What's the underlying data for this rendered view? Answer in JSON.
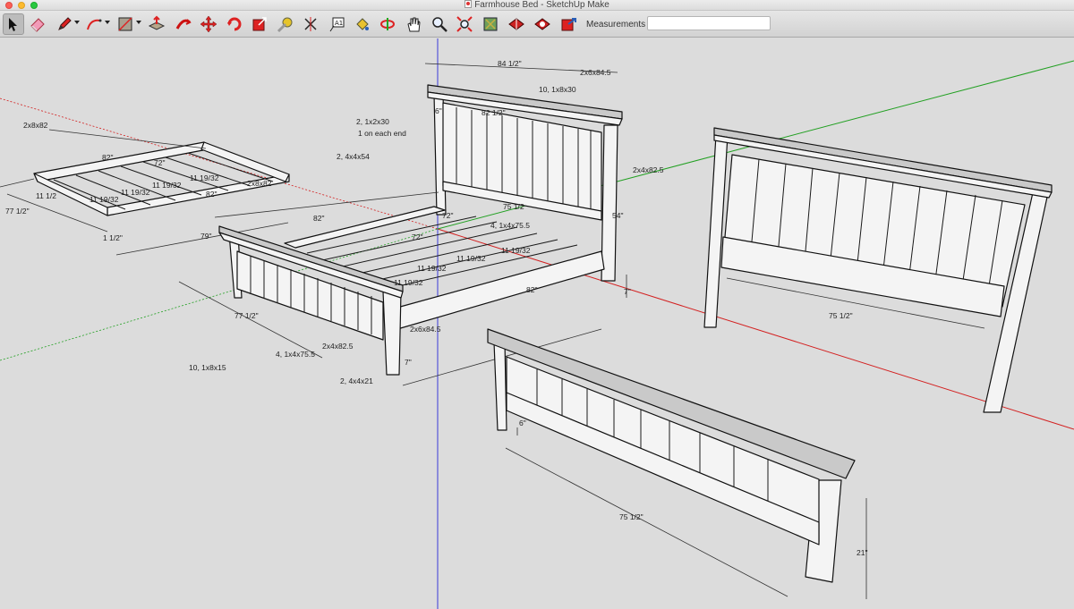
{
  "window": {
    "title": "Farmhouse Bed - SketchUp Make"
  },
  "toolbar": {
    "tools": [
      {
        "name": "select-tool-icon",
        "active": true
      },
      {
        "name": "eraser-tool-icon"
      },
      {
        "name": "pencil-tool-icon"
      },
      {
        "name": "arc-tool-icon"
      },
      {
        "name": "rectangle-tool-icon"
      },
      {
        "name": "push-pull-tool-icon"
      },
      {
        "name": "follow-me-tool-icon"
      },
      {
        "name": "move-tool-icon"
      },
      {
        "name": "rotate-tool-icon"
      },
      {
        "name": "scale-tool-icon"
      },
      {
        "name": "tape-measure-tool-icon"
      },
      {
        "name": "dimension-tool-icon"
      },
      {
        "name": "text-tool-icon"
      },
      {
        "name": "paint-bucket-tool-icon"
      },
      {
        "name": "orbit-tool-icon"
      },
      {
        "name": "pan-tool-icon"
      },
      {
        "name": "zoom-tool-icon"
      },
      {
        "name": "zoom-extents-tool-icon"
      },
      {
        "name": "add-location-icon"
      },
      {
        "name": "warehouse-icon"
      },
      {
        "name": "extension-warehouse-icon"
      },
      {
        "name": "share-model-icon"
      }
    ],
    "measurements_label": "Measurements",
    "measurements_value": ""
  },
  "annotations": {
    "slats_2x8x82": "2x8x82",
    "slats_82_a": "82\"",
    "slats_72": "72\"",
    "slats_1112_a": "11 1/2",
    "slats_1119_a": "11 19/32",
    "slats_1119_b": "11 19/32",
    "slats_1119_c": "11 19/32",
    "slats_1119_d": "11 19/32",
    "slats_2x8x82_b": "2x8x82",
    "slats_82_b": "82\"",
    "slats_77_5": "77 1/2\"",
    "slats_1_5": "1 1/2\"",
    "slats_79": "79\"",
    "bed_82": "82\"",
    "bed_72": "72\"",
    "bed_75_5": "75 1/2",
    "bed_1x4x75": "4, 1x4x75.5",
    "bed_1119_a": "11 19/32",
    "bed_1119_b": "11 19/32",
    "bed_1119_c": "11 19/32",
    "bed_1119_d": "11 19/32",
    "bed_82_b": "82\"",
    "bed_77_5": "77 1/2\"",
    "bed_2x4x82": "2x4x82.5",
    "bed_4_1x4x75": "4, 1x4x75.5",
    "bed_2x6x84": "2x6x84.5",
    "bed_10_1x8x15": "10, 1x8x15",
    "bed_2_4x4x21": "2, 4x4x21",
    "bed_7": "7\"",
    "bed_7b": "7\"",
    "hb_84_5": "84 1/2\"",
    "hb_2x6x84": "2x6x84.5",
    "hb_10_1x8x30": "10, 1x8x30",
    "hb_82_5": "82 1/2\"",
    "hb_2_1x2x30": "2, 1x2x30",
    "hb_1_each_end": "1 on each end",
    "hb_2_4x4x54": "2, 4x4x54",
    "hb_2x4x82": "2x4x82.5",
    "hb_54": "54\"",
    "hb_6": "6\"",
    "hb_right_75_5": "75 1/2\"",
    "fb_6": "6\"",
    "fb_75_5": "75 1/2\"",
    "fb_21": "21\""
  },
  "colors": {
    "background": "#dcdcdc",
    "axis_red": "#d32020",
    "axis_green": "#22a022",
    "axis_blue": "#3a3ad8"
  }
}
